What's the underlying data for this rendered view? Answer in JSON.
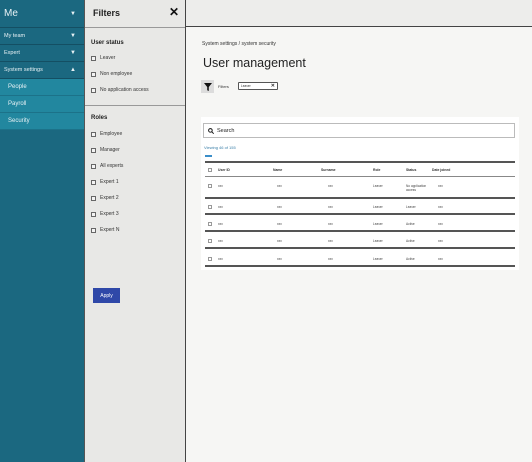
{
  "nav": {
    "me": "Me",
    "items": [
      {
        "label": "My team"
      },
      {
        "label": "Expert"
      },
      {
        "label": "System settings"
      }
    ],
    "subitems": [
      {
        "label": "People"
      },
      {
        "label": "Payroll"
      },
      {
        "label": "Security"
      }
    ]
  },
  "filters": {
    "title": "Filters",
    "close": "✕",
    "user_status_heading": "User status",
    "user_status": [
      "Leaver",
      "Non employee",
      "No application access"
    ],
    "roles_heading": "Roles",
    "roles": [
      "Employee",
      "Manager",
      "All experts",
      "Expert 1",
      "Expert 2",
      "Expert 3",
      "Expert N"
    ],
    "apply_label": "Apply"
  },
  "main": {
    "breadcrumb": "System settings / system security",
    "title": "User management",
    "filters_label": "Filters",
    "chip_label": "Leaver",
    "chip_close": "✕",
    "search_placeholder": "Search",
    "viewing": "Viewing 46 of 155",
    "columns": [
      "User ID",
      "Name",
      "Surname",
      "Role",
      "Status",
      "Date joined"
    ],
    "rows": [
      [
        "xxx",
        "xxx",
        "xxx",
        "Leaver",
        "No application access",
        "xxx"
      ],
      [
        "xxx",
        "xxx",
        "xxx",
        "Leaver",
        "Leaver",
        "xxx"
      ],
      [
        "xxx",
        "xxx",
        "xxx",
        "Leaver",
        "Active",
        "xxx"
      ],
      [
        "xxx",
        "xxx",
        "xxx",
        "Leaver",
        "Active",
        "xxx"
      ],
      [
        "xxx",
        "xxx",
        "xxx",
        "Leaver",
        "Active",
        "xxx"
      ]
    ]
  },
  "colors": {
    "nav_bg": "#1b6880",
    "nav_sub_bg": "#22879f",
    "apply_bg": "#2f48a8",
    "accent": "#3b8ec9"
  }
}
